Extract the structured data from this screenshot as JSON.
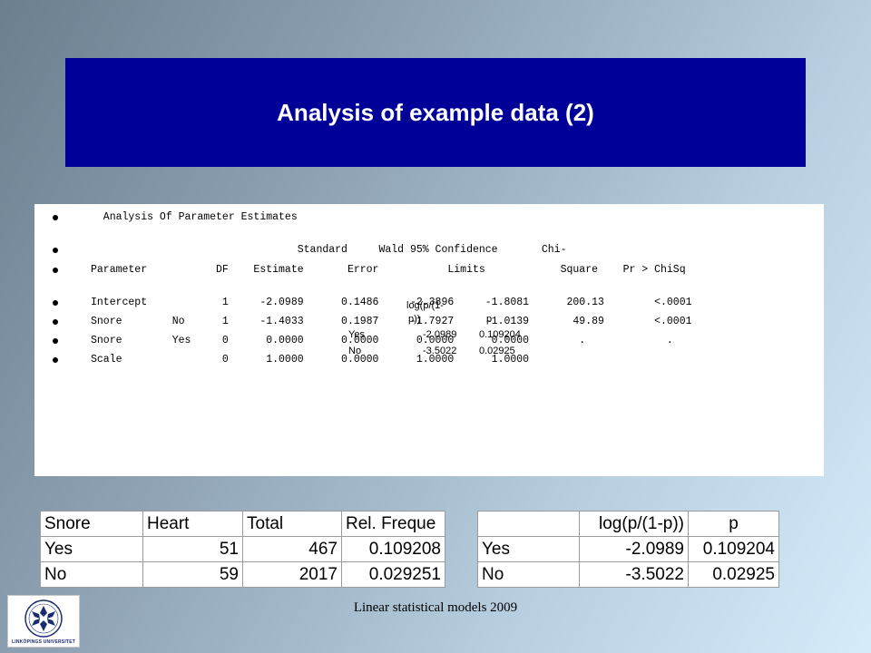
{
  "title": "Analysis of example data (2)",
  "sas_output": {
    "lines": [
      "  Analysis Of Parameter Estimates",
      "",
      "                                 Standard     Wald 95% Confidence       Chi-",
      "Parameter           DF    Estimate       Error           Limits            Square    Pr > ChiSq",
      "",
      "Intercept            1     -2.0989      0.1486     -2.3896     -1.8081      200.13        <.0001",
      "Snore        No      1     -1.4033      0.1987     -1.7927     -1.0139       49.89        <.0001",
      "Snore        Yes     0      0.0000      0.0000      0.0000      0.0000        .             .",
      "Scale                0      1.0000      0.0000      1.0000      1.0000"
    ]
  },
  "overlay_table": {
    "header_line1": "log(p/(1-",
    "header_line2": "p))",
    "header_p": "p",
    "rows": [
      {
        "label": "Yes",
        "logit": "-2.0989",
        "p": "0.109204"
      },
      {
        "label": "No",
        "logit": "-3.5022",
        "p": "0.02925"
      }
    ]
  },
  "freq_table": {
    "headers": [
      "Snore",
      "Heart",
      "Total",
      "Rel. Freque"
    ],
    "rows": [
      [
        "Yes",
        "51",
        "467",
        "0.109208"
      ],
      [
        "No",
        "59",
        "2017",
        "0.029251"
      ]
    ]
  },
  "logit_table": {
    "headers": [
      "",
      "log(p/(1-p))",
      "p"
    ],
    "rows": [
      [
        "Yes",
        "-2.0989",
        "0.109204"
      ],
      [
        "No",
        "-3.5022",
        "0.02925"
      ]
    ]
  },
  "logo_caption": "LINKÖPINGS UNIVERSITET",
  "footer": "Linear statistical models 2009",
  "colors": {
    "title_bg": "#000099",
    "title_text": "#ffffff",
    "logo_blue": "#1a2d6e"
  }
}
